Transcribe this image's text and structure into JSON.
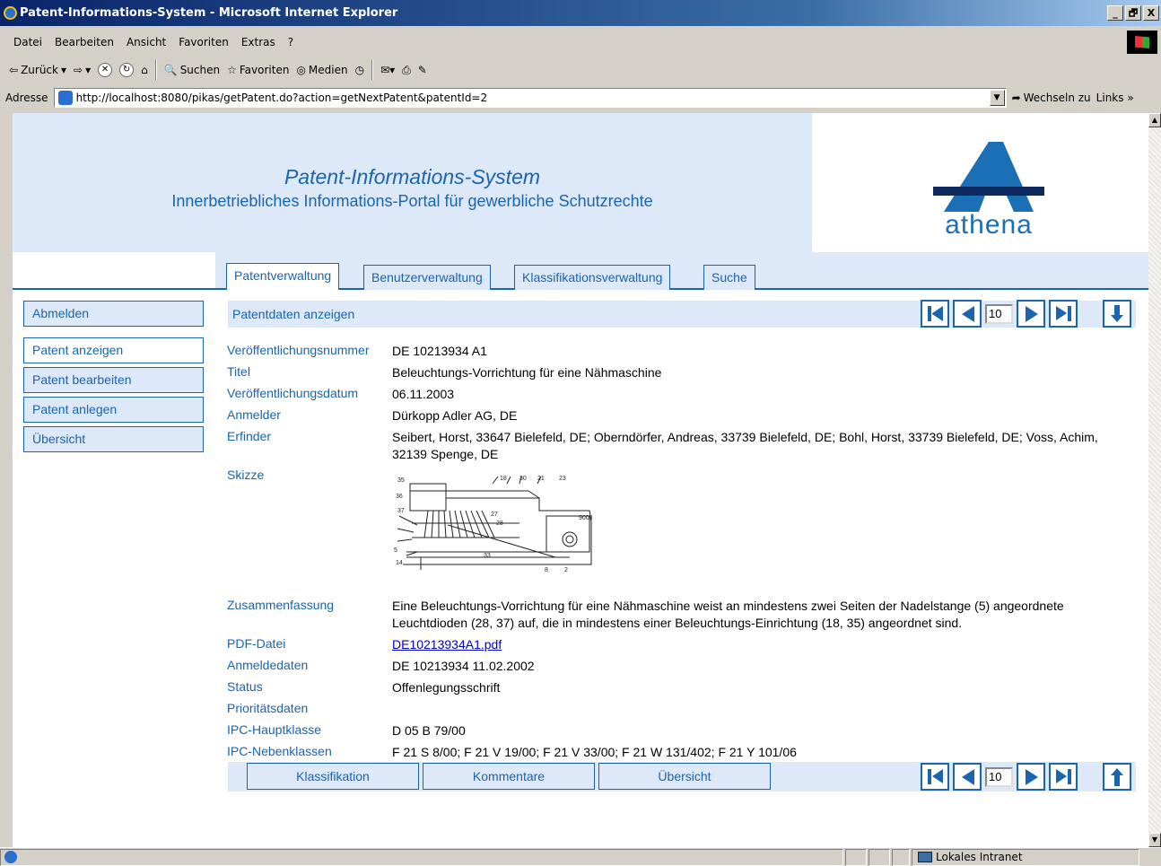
{
  "window": {
    "title": "Patent-Informations-System - Microsoft Internet Explorer",
    "buttons": [
      "_",
      "🗗",
      "X"
    ]
  },
  "menu": [
    "Datei",
    "Bearbeiten",
    "Ansicht",
    "Favoriten",
    "Extras",
    "?"
  ],
  "toolbar": {
    "back": "Zurück",
    "search": "Suchen",
    "favorites": "Favoriten",
    "media": "Medien"
  },
  "address": {
    "label": "Adresse",
    "url": "http://localhost:8080/pikas/getPatent.do?action=getNextPatent&patentId=2",
    "go": "Wechseln zu",
    "links": "Links"
  },
  "header": {
    "title": "Patent-Informations-System",
    "subtitle": "Innerbetriebliches Informations-Portal für gewerbliche Schutzrechte",
    "logo_text": "athena"
  },
  "tabs": [
    {
      "label": "Patentverwaltung",
      "active": true
    },
    {
      "label": "Benutzerverwaltung",
      "active": false
    },
    {
      "label": "Klassifikationsverwaltung",
      "active": false
    },
    {
      "label": "Suche",
      "active": false
    }
  ],
  "sidebar": [
    {
      "label": "Abmelden"
    },
    {
      "label": "Patent anzeigen"
    },
    {
      "label": "Patent bearbeiten"
    },
    {
      "label": "Patent anlegen"
    },
    {
      "label": "Übersicht"
    }
  ],
  "panel": {
    "title": "Patentdaten anzeigen",
    "page_size": "10"
  },
  "fields": {
    "veroeff_nr": {
      "label": "Veröffentlichungsnummer",
      "value": "DE 10213934 A1"
    },
    "titel": {
      "label": "Titel",
      "value": "Beleuchtungs-Vorrichtung für eine Nähmaschine"
    },
    "veroeff_datum": {
      "label": "Veröffentlichungsdatum",
      "value": "06.11.2003"
    },
    "anmelder": {
      "label": "Anmelder",
      "value": "Dürkopp Adler AG,  DE"
    },
    "erfinder": {
      "label": "Erfinder",
      "value": "Seibert, Horst,  33647 Bielefeld,  DE;  Oberndörfer, Andreas,  33739 Bielefeld,  DE;  Bohl, Horst,  33739 Bielefeld,  DE;  Voss, Achim,  32139 Spenge,  DE"
    },
    "skizze": {
      "label": "Skizze"
    },
    "zusammenfassung": {
      "label": "Zusammenfassung",
      "value": "Eine Beleuchtungs-Vorrichtung für eine Nähmaschine weist an mindestens zwei Seiten der Nadelstange (5) angeordnete Leuchtdioden (28, 37) auf, die in mindestens einer Beleuchtungs-Einrichtung (18, 35) angeordnet sind."
    },
    "pdf": {
      "label": "PDF-Datei",
      "value": "DE10213934A1.pdf"
    },
    "anmeldedaten": {
      "label": "Anmeldedaten",
      "value": "DE 10213934 11.02.2002"
    },
    "status": {
      "label": "Status",
      "value": "Offenlegungsschrift"
    },
    "prioritaet": {
      "label": "Prioritätsdaten",
      "value": ""
    },
    "ipc_haupt": {
      "label": "IPC-Hauptklasse",
      "value": "D 05 B 79/00"
    },
    "ipc_neben": {
      "label": "IPC-Nebenklassen",
      "value": "F 21 S 8/00;  F 21 V 19/00;  F 21 V 33/00;  F 21 W 131/402;  F 21 Y 101/06"
    }
  },
  "bottom_buttons": [
    "Klassifikation",
    "Kommentare",
    "Übersicht"
  ],
  "status_bar": {
    "zone": "Lokales Intranet"
  },
  "colors": {
    "accent": "#1a64b0",
    "panel_bg": "#dde8f8"
  }
}
